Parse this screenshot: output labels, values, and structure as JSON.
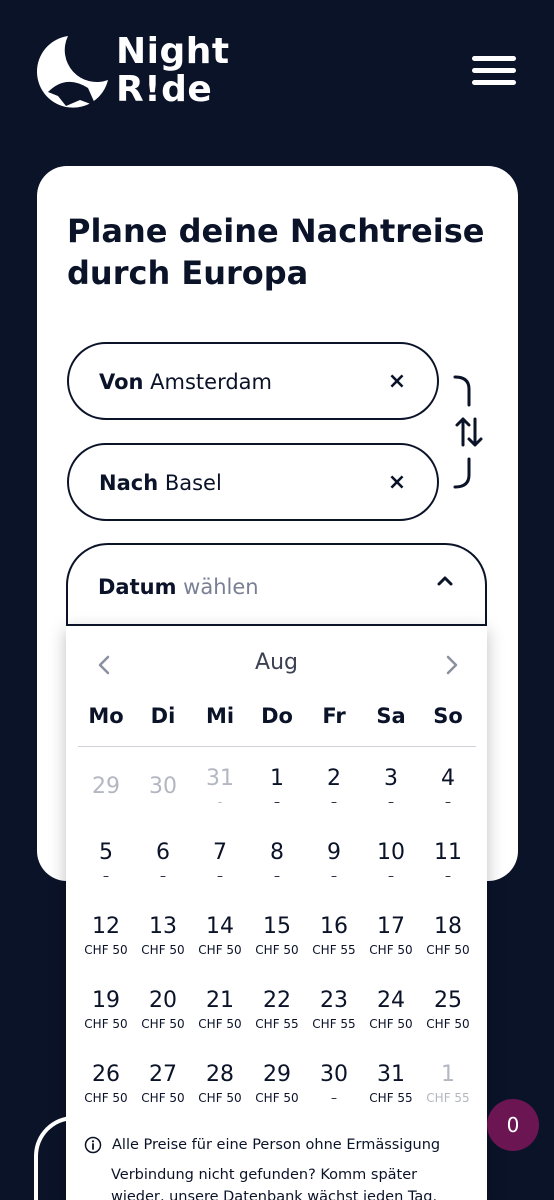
{
  "header": {
    "logo_line1": "Night",
    "logo_line2": "R!de"
  },
  "search": {
    "title": "Plane deine Nachtreise durch Europa",
    "from_label": "Von",
    "from_value": "Amsterdam",
    "to_label": "Nach",
    "to_value": "Basel",
    "clear_symbol": "×",
    "date_label": "Datum",
    "date_placeholder": "wählen"
  },
  "calendar": {
    "month": "Aug",
    "weekdays": [
      "Mo",
      "Di",
      "Mi",
      "Do",
      "Fr",
      "Sa",
      "So"
    ],
    "days": [
      {
        "n": "29",
        "p": "",
        "d": true
      },
      {
        "n": "30",
        "p": "",
        "d": true
      },
      {
        "n": "31",
        "p": "-",
        "d": true
      },
      {
        "n": "1",
        "p": "–",
        "d": false
      },
      {
        "n": "2",
        "p": "–",
        "d": false
      },
      {
        "n": "3",
        "p": "–",
        "d": false
      },
      {
        "n": "4",
        "p": "–",
        "d": false
      },
      {
        "n": "5",
        "p": "–",
        "d": false
      },
      {
        "n": "6",
        "p": "–",
        "d": false
      },
      {
        "n": "7",
        "p": "–",
        "d": false
      },
      {
        "n": "8",
        "p": "–",
        "d": false
      },
      {
        "n": "9",
        "p": "–",
        "d": false
      },
      {
        "n": "10",
        "p": "–",
        "d": false
      },
      {
        "n": "11",
        "p": "–",
        "d": false
      },
      {
        "n": "12",
        "p": "CHF 50",
        "d": false
      },
      {
        "n": "13",
        "p": "CHF 50",
        "d": false
      },
      {
        "n": "14",
        "p": "CHF 50",
        "d": false
      },
      {
        "n": "15",
        "p": "CHF 50",
        "d": false
      },
      {
        "n": "16",
        "p": "CHF 55",
        "d": false
      },
      {
        "n": "17",
        "p": "CHF 50",
        "d": false
      },
      {
        "n": "18",
        "p": "CHF 50",
        "d": false
      },
      {
        "n": "19",
        "p": "CHF 50",
        "d": false
      },
      {
        "n": "20",
        "p": "CHF 50",
        "d": false
      },
      {
        "n": "21",
        "p": "CHF 50",
        "d": false
      },
      {
        "n": "22",
        "p": "CHF 55",
        "d": false
      },
      {
        "n": "23",
        "p": "CHF 55",
        "d": false
      },
      {
        "n": "24",
        "p": "CHF 50",
        "d": false
      },
      {
        "n": "25",
        "p": "CHF 50",
        "d": false
      },
      {
        "n": "26",
        "p": "CHF 50",
        "d": false
      },
      {
        "n": "27",
        "p": "CHF 50",
        "d": false
      },
      {
        "n": "28",
        "p": "CHF 50",
        "d": false
      },
      {
        "n": "29",
        "p": "CHF 50",
        "d": false
      },
      {
        "n": "30",
        "p": "–",
        "d": false
      },
      {
        "n": "31",
        "p": "CHF 55",
        "d": false
      },
      {
        "n": "1",
        "p": "CHF 55",
        "d": true
      }
    ],
    "note_prices": "Alle Preise für eine Person ohne Ermässigung",
    "note_missing": "Verbindung nicht gefunden? Komm später wieder, unsere Datenbank wächst jeden Tag."
  },
  "chat_badge": "0",
  "colors": {
    "background": "#0b1329",
    "card": "#ffffff",
    "badge": "#6b1552",
    "disabled_text": "#b3b7c1"
  }
}
